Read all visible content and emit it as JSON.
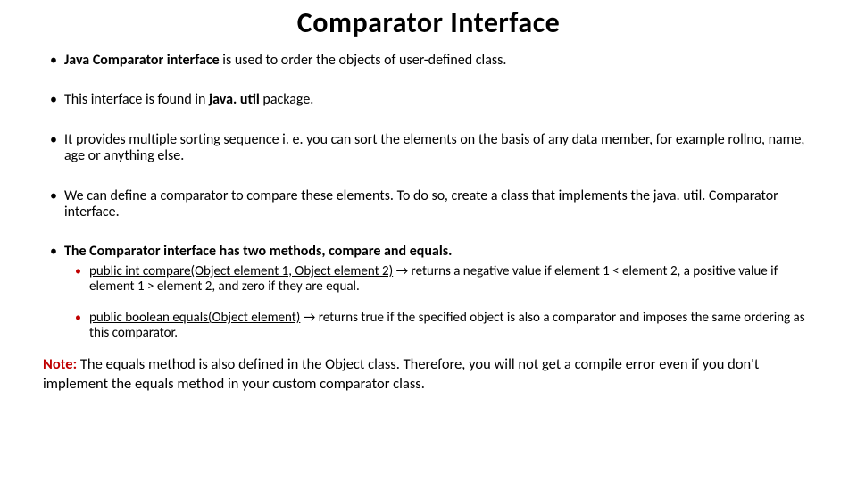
{
  "title": "Comparator Interface",
  "bullets": {
    "b1_bold": "Java Comparator interface",
    "b1_rest": " is used to order the objects of user-defined class.",
    "b2_a": "This interface is found in ",
    "b2_pkg": "java. util",
    "b2_b": " package.",
    "b3": "It provides multiple sorting sequence i. e. you can sort the elements on the basis of any data member, for example rollno, name, age or anything else.",
    "b4": "We can define a comparator to compare these elements. To do so, create a class that implements the java. util. Comparator interface.",
    "b5": "The Comparator interface has two methods, compare and equals.",
    "s1_sig": "public int compare(Object element 1, Object element 2)",
    "s1_arrow": " → ",
    "s1_rest": "returns a negative value if element 1 < element 2, a positive value if element 1 > element 2, and zero if they are equal.",
    "s2_sig": "public boolean equals(Object element)",
    "s2_arrow": " → ",
    "s2_rest": "returns true if the specified object is also a comparator and imposes the same ordering as this comparator."
  },
  "note": {
    "label": "Note:",
    "t1": " The ",
    "c1": "equals",
    "t2": " method is also defined in the ",
    "c2": "Object",
    "t3": " class. Therefore, you will not get a compile error even if you don't implement the ",
    "c3": "equals",
    "t4": " method in your custom comparator class."
  }
}
